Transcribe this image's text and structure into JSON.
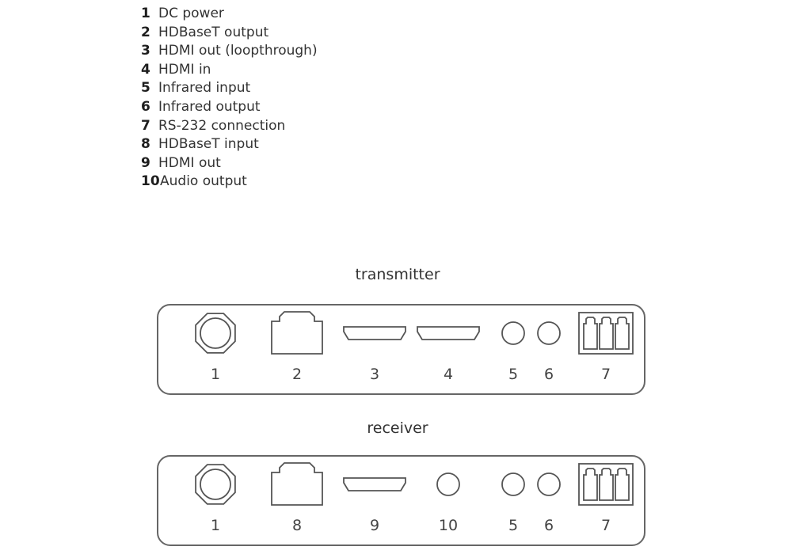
{
  "legend": [
    {
      "num": "1",
      "label": "DC power"
    },
    {
      "num": "2",
      "label": "HDBaseT output"
    },
    {
      "num": "3",
      "label": "HDMI out (loopthrough)"
    },
    {
      "num": "4",
      "label": "HDMI in"
    },
    {
      "num": "5",
      "label": "Infrared input"
    },
    {
      "num": "6",
      "label": "Infrared output"
    },
    {
      "num": "7",
      "label": "RS-232 connection"
    },
    {
      "num": "8",
      "label": "HDBaseT input"
    },
    {
      "num": "9",
      "label": "HDMI out"
    },
    {
      "num": "10",
      "label": "Audio output"
    }
  ],
  "transmitter": {
    "title": "transmitter",
    "ports": [
      {
        "num": "1",
        "type": "dc-power"
      },
      {
        "num": "2",
        "type": "rj45"
      },
      {
        "num": "3",
        "type": "hdmi"
      },
      {
        "num": "4",
        "type": "hdmi"
      },
      {
        "num": "5",
        "type": "jack"
      },
      {
        "num": "6",
        "type": "jack"
      },
      {
        "num": "7",
        "type": "terminal-block"
      }
    ]
  },
  "receiver": {
    "title": "receiver",
    "ports": [
      {
        "num": "1",
        "type": "dc-power"
      },
      {
        "num": "8",
        "type": "rj45"
      },
      {
        "num": "9",
        "type": "hdmi"
      },
      {
        "num": "10",
        "type": "jack"
      },
      {
        "num": "5",
        "type": "jack"
      },
      {
        "num": "6",
        "type": "jack"
      },
      {
        "num": "7",
        "type": "terminal-block"
      }
    ]
  },
  "colors": {
    "stroke": "#555555",
    "text": "#333333"
  }
}
